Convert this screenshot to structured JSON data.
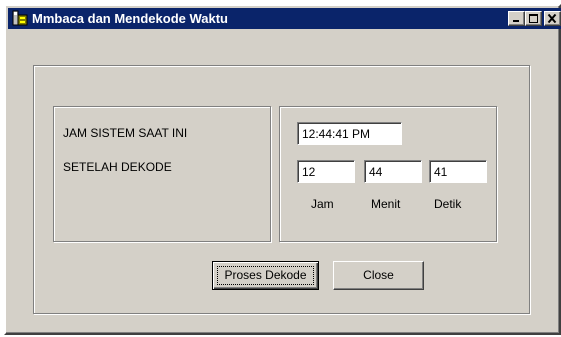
{
  "window": {
    "title": "Mmbaca dan Mendekode Waktu",
    "title_bar_color": "#0a246a",
    "face_color": "#d4d0c8",
    "controls": {
      "minimize": "minimize-icon",
      "maximize": "maximize-icon",
      "close": "close-icon"
    }
  },
  "labels": {
    "system_time": "JAM SISTEM SAAT INI",
    "after_decode": "SETELAH DEKODE",
    "hour": "Jam",
    "minute": "Menit",
    "second": "Detik"
  },
  "fields": {
    "system_time": "12:44:41 PM",
    "hour": "12",
    "minute": "44",
    "second": "41"
  },
  "buttons": {
    "decode": "Proses Dekode",
    "close": "Close"
  }
}
